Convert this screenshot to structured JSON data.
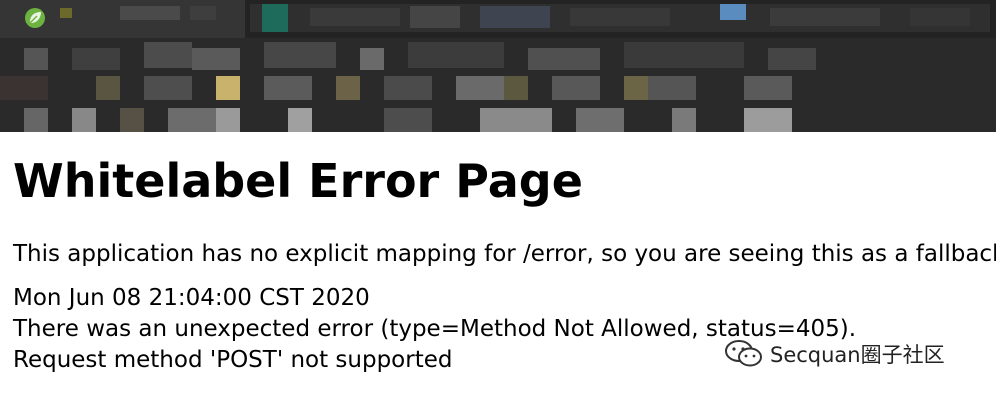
{
  "page": {
    "title": "Whitelabel Error Page",
    "message": "This application has no explicit mapping for /error, so you are seeing this as a fallback.",
    "timestamp": "Mon Jun 08 21:04:00 CST 2020",
    "error_line": "There was an unexpected error (type=Method Not Allowed, status=405).",
    "detail": "Request method 'POST' not supported"
  },
  "watermark": {
    "text": "Secquan圈子社区",
    "icon": "wechat-icon"
  },
  "browser": {
    "tab_icon": "spring-leaf-icon",
    "accent_color": "#6db33f"
  }
}
